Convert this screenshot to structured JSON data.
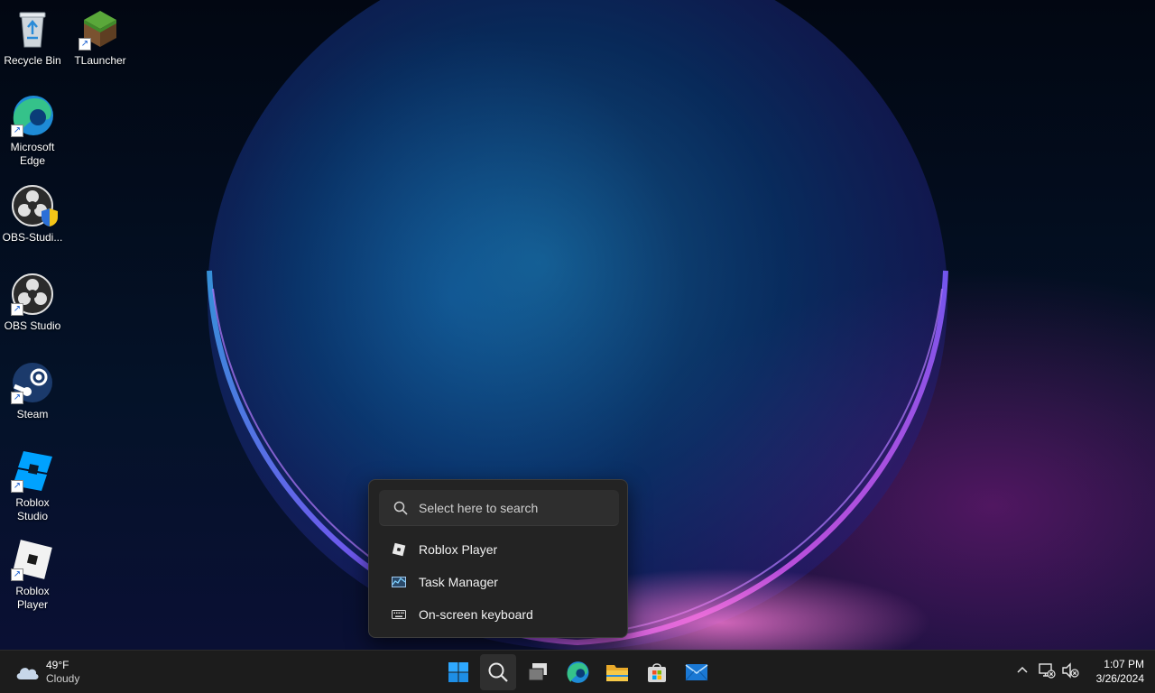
{
  "desktop": {
    "icons": [
      {
        "label": "Recycle Bin",
        "icon": "recycle-bin-icon"
      },
      {
        "label": "TLauncher",
        "icon": "tlauncher-icon"
      },
      {
        "label": "Microsoft Edge",
        "icon": "edge-icon"
      },
      {
        "label": "OBS-Studi...",
        "icon": "obs-icon"
      },
      {
        "label": "OBS Studio",
        "icon": "obs-icon"
      },
      {
        "label": "Steam",
        "icon": "steam-icon"
      },
      {
        "label": "Roblox Studio",
        "icon": "roblox-studio-icon"
      },
      {
        "label": "Roblox Player",
        "icon": "roblox-player-icon"
      }
    ]
  },
  "search_flyout": {
    "placeholder": "Select here to search",
    "items": [
      {
        "label": "Roblox Player",
        "icon": "roblox-player-icon"
      },
      {
        "label": "Task Manager",
        "icon": "task-manager-icon"
      },
      {
        "label": "On-screen keyboard",
        "icon": "keyboard-icon"
      }
    ]
  },
  "taskbar": {
    "weather": {
      "temp": "49°F",
      "condition": "Cloudy",
      "icon": "cloud-icon"
    },
    "apps": [
      {
        "name": "start",
        "icon": "windows-icon"
      },
      {
        "name": "search",
        "icon": "search-icon",
        "active": true
      },
      {
        "name": "task-view",
        "icon": "task-view-icon"
      },
      {
        "name": "edge",
        "icon": "edge-icon"
      },
      {
        "name": "file-explorer",
        "icon": "folder-icon"
      },
      {
        "name": "store",
        "icon": "store-icon"
      },
      {
        "name": "mail",
        "icon": "mail-icon"
      }
    ],
    "clock": {
      "time": "1:07 PM",
      "date": "3/26/2024"
    }
  },
  "colors": {
    "accent": "#0078d4",
    "taskbar_bg": "#1c1c1c",
    "flyout_bg": "#232323"
  }
}
